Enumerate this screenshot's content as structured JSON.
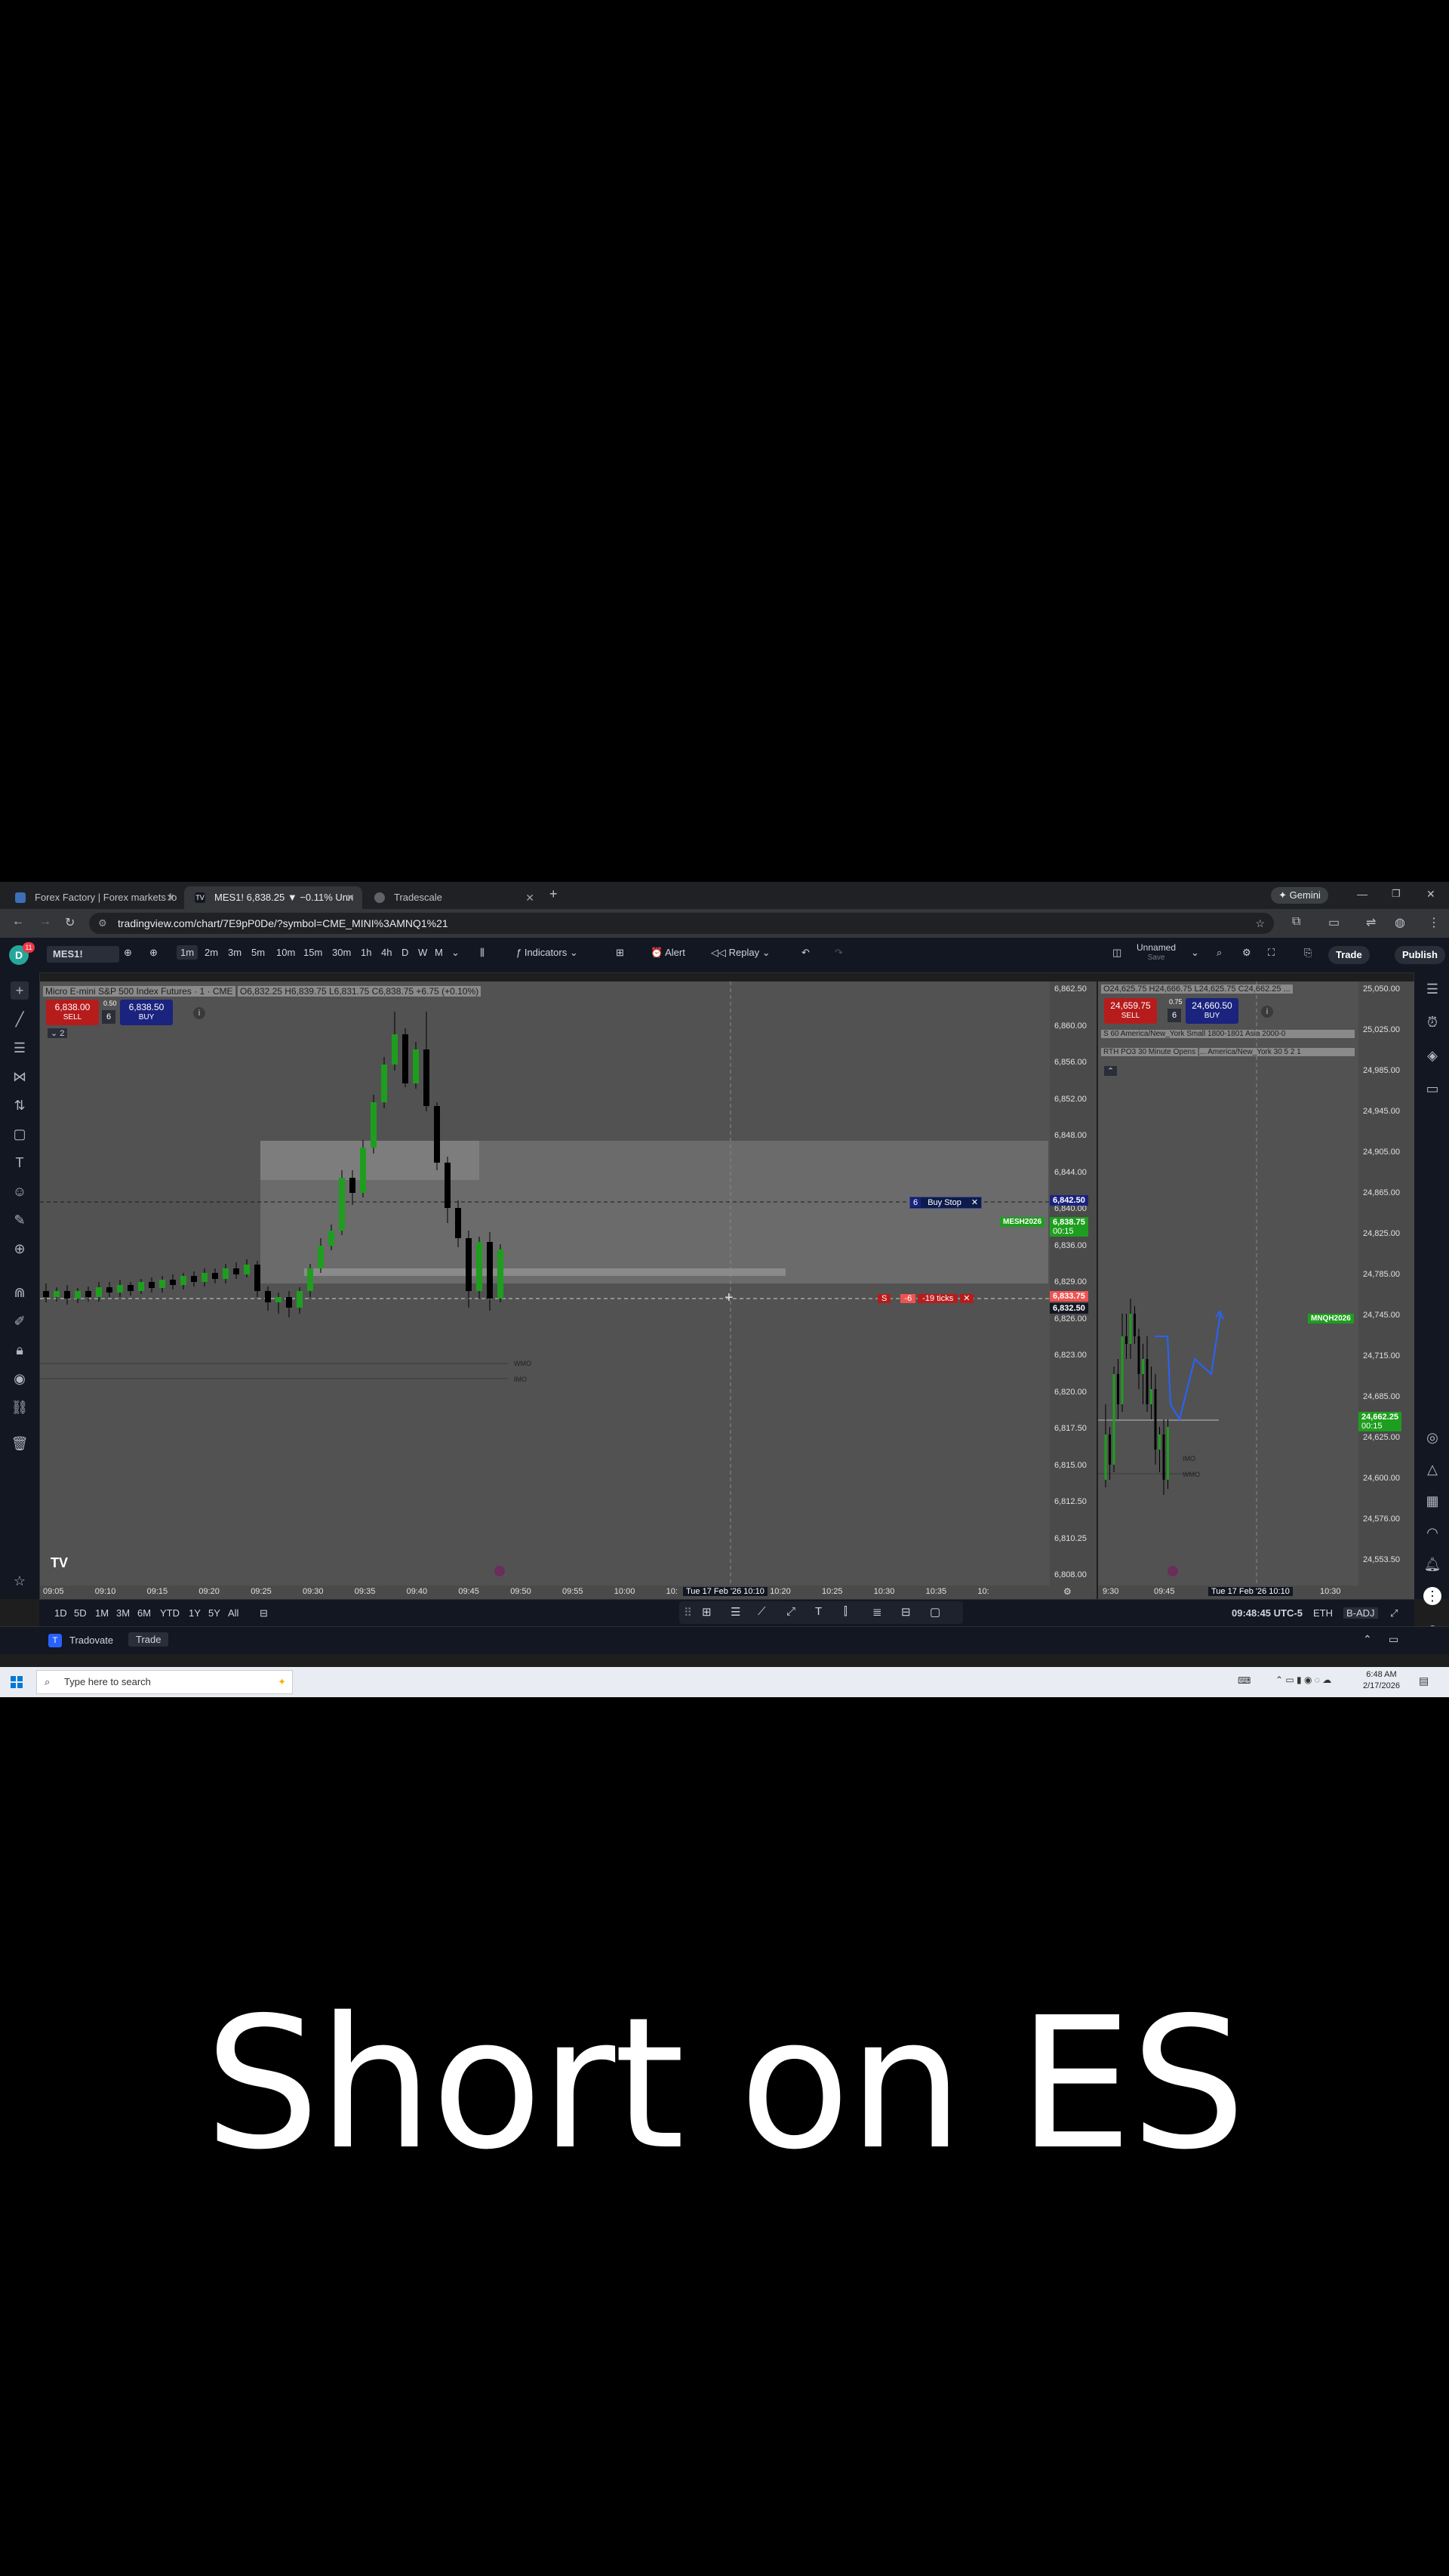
{
  "browser": {
    "tabs": [
      {
        "label": "Forex Factory | Forex markets fo"
      },
      {
        "label": "MES1! 6,838.25 ▼ −0.11% Unn"
      },
      {
        "label": "Tradescale"
      }
    ],
    "gemini_label": "Gemini",
    "url": "tradingview.com/chart/7E9pP0De/?symbol=CME_MINI%3AMNQ1%21"
  },
  "toolbar": {
    "symbol": "MES1!",
    "avatar_badge": "11",
    "avatar_letter": "D",
    "intervals": [
      "1m",
      "2m",
      "3m",
      "5m",
      "10m",
      "15m",
      "30m",
      "1h",
      "4h",
      "D",
      "W",
      "M"
    ],
    "selected_interval": "1m",
    "indicators_label": "Indicators",
    "alert_label": "Alert",
    "replay_label": "Replay",
    "layout_name": "Unnamed",
    "layout_sub": "Save",
    "trade_label": "Trade",
    "publish_label": "Publish"
  },
  "left_chart": {
    "legend": "Micro E-mini S&P 500 Index Futures · 1 · CME",
    "ohlc": "O6,832.25 H6,839.75 L6,831.75 C6,838.75 +6.75 (+0.10%)",
    "sell_price": "6,838.00",
    "sell_label": "SELL",
    "spread": "0.50",
    "qty": "6",
    "buy_price": "6,838.50",
    "buy_label": "BUY",
    "collapse_count": "2",
    "price_ticks": [
      "6,862.50",
      "6,860.00",
      "6,856.00",
      "6,852.00",
      "6,848.00",
      "6,844.00",
      "6,840.00",
      "6,836.00",
      "6,829.00",
      "6,826.00",
      "6,823.00",
      "6,820.00",
      "6,817.50",
      "6,815.00",
      "6,812.50",
      "6,810.25",
      "6,808.00"
    ],
    "time_ticks": [
      "09:05",
      "09:10",
      "09:15",
      "09:20",
      "09:25",
      "09:30",
      "09:35",
      "09:40",
      "09:45",
      "09:50",
      "09:55",
      "10:00",
      "10:",
      "10:15",
      "10:20",
      "10:25",
      "10:30",
      "10:35",
      "10:"
    ],
    "crosshair_time": "Tue 17 Feb '26  10:10",
    "buy_stop_qty": "6",
    "buy_stop_label": "Buy Stop",
    "buy_stop_price": "6,842.50",
    "symbol_tag": "MESH2026",
    "last_price": "6,838.75",
    "last_countdown": "00:15",
    "position_qty": "6",
    "position_side": "S",
    "position_pnl": "-6",
    "position_ticks": "-19 ticks",
    "position_price": "6,833.75",
    "crosshair_price": "6,832.50",
    "level_labels": [
      "WMO",
      "IMO"
    ]
  },
  "right_chart": {
    "ohlc": "O24,625.75 H24,666.75 L24,625.75 C24,662.25 ...",
    "sell_price": "24,659.75",
    "sell_label": "SELL",
    "spread": "0.75",
    "qty": "6",
    "buy_price": "24,660.50",
    "buy_label": "BUY",
    "indicator_1": "S 60 America/New_York Small 1800-1801 Asia 2000-0",
    "indicator_2": "RTH PO3 30 Minute Opens [... America/New_York 30 5 2 1",
    "price_ticks": [
      "25,050.00",
      "25,025.00",
      "24,985.00",
      "24,945.00",
      "24,905.00",
      "24,865.00",
      "24,825.00",
      "24,785.00",
      "24,745.00",
      "24,715.00",
      "24,685.00",
      "24,625.00",
      "24,600.00",
      "24,576.00",
      "24,553.50",
      "24,531.50"
    ],
    "time_ticks": [
      "9:30",
      "09:45",
      "10:30"
    ],
    "crosshair_time": "Tue 17 Feb '26  10:10",
    "symbol_tag": "MNQH2026",
    "last_price": "24,662.25",
    "last_countdown": "00:15",
    "level_labels": [
      "IMO",
      "WMO"
    ]
  },
  "bottom": {
    "ranges": [
      "1D",
      "5D",
      "1M",
      "3M",
      "6M",
      "YTD",
      "1Y",
      "5Y",
      "All"
    ],
    "clock": "09:48:45 UTC-5",
    "session": "ETH",
    "adj": "B-ADJ"
  },
  "panel": {
    "broker": "Tradovate",
    "trade_btn": "Trade"
  },
  "taskbar": {
    "search_placeholder": "Type here to search",
    "time": "6:48 AM",
    "date": "2/17/2026"
  },
  "caption": "Short on ES",
  "colors": {
    "bull": "#1e9e1e",
    "bear": "#000000",
    "sell": "#b71c1c",
    "buy": "#1a237e",
    "projection": "#2962ff"
  }
}
